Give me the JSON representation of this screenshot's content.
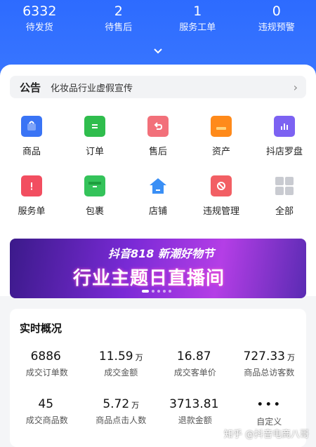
{
  "header": {
    "stats": [
      {
        "value": "6332",
        "label": "待发货"
      },
      {
        "value": "2",
        "label": "待售后"
      },
      {
        "value": "1",
        "label": "服务工单"
      },
      {
        "value": "0",
        "label": "违规预警"
      }
    ]
  },
  "notice": {
    "tag": "公告",
    "text": "化妆品行业虚假宣传"
  },
  "grid": [
    {
      "label": "商品",
      "icon": "shopping-bag-icon",
      "color": "#3a74f5"
    },
    {
      "label": "订单",
      "icon": "order-icon",
      "color": "#2fbd4d"
    },
    {
      "label": "售后",
      "icon": "return-icon",
      "color": "#f2707a"
    },
    {
      "label": "资产",
      "icon": "wallet-icon",
      "color": "#ff8a1a"
    },
    {
      "label": "抖店罗盘",
      "icon": "chart-icon",
      "color": "#7c62f2"
    },
    {
      "label": "服务单",
      "icon": "alert-icon",
      "color": "#f24e60"
    },
    {
      "label": "包裹",
      "icon": "box-icon",
      "color": "#34c35a"
    },
    {
      "label": "店铺",
      "icon": "store-icon",
      "color": "#3a8ff5"
    },
    {
      "label": "违规管理",
      "icon": "ban-icon",
      "color": "#f25f64"
    },
    {
      "label": "全部",
      "icon": "grid-icon",
      "color": "#c9cbd1"
    }
  ],
  "banner": {
    "line1": "抖音818 新潮好物节",
    "line2": "行业主题日直播间"
  },
  "realtime": {
    "title": "实时概况",
    "metrics": [
      {
        "value": "6886",
        "unit": "",
        "label": "成交订单数"
      },
      {
        "value": "11.59",
        "unit": "万",
        "label": "成交金额"
      },
      {
        "value": "16.87",
        "unit": "",
        "label": "成交客单价"
      },
      {
        "value": "727.33",
        "unit": "万",
        "label": "商品总访客数"
      },
      {
        "value": "45",
        "unit": "",
        "label": "成交商品数"
      },
      {
        "value": "5.72",
        "unit": "万",
        "label": "商品点击人数"
      },
      {
        "value": "3713.81",
        "unit": "",
        "label": "退款金额"
      },
      {
        "value": "•••",
        "unit": "",
        "label": "自定义"
      }
    ]
  },
  "watermark": "知乎 @抖音电商八哥"
}
